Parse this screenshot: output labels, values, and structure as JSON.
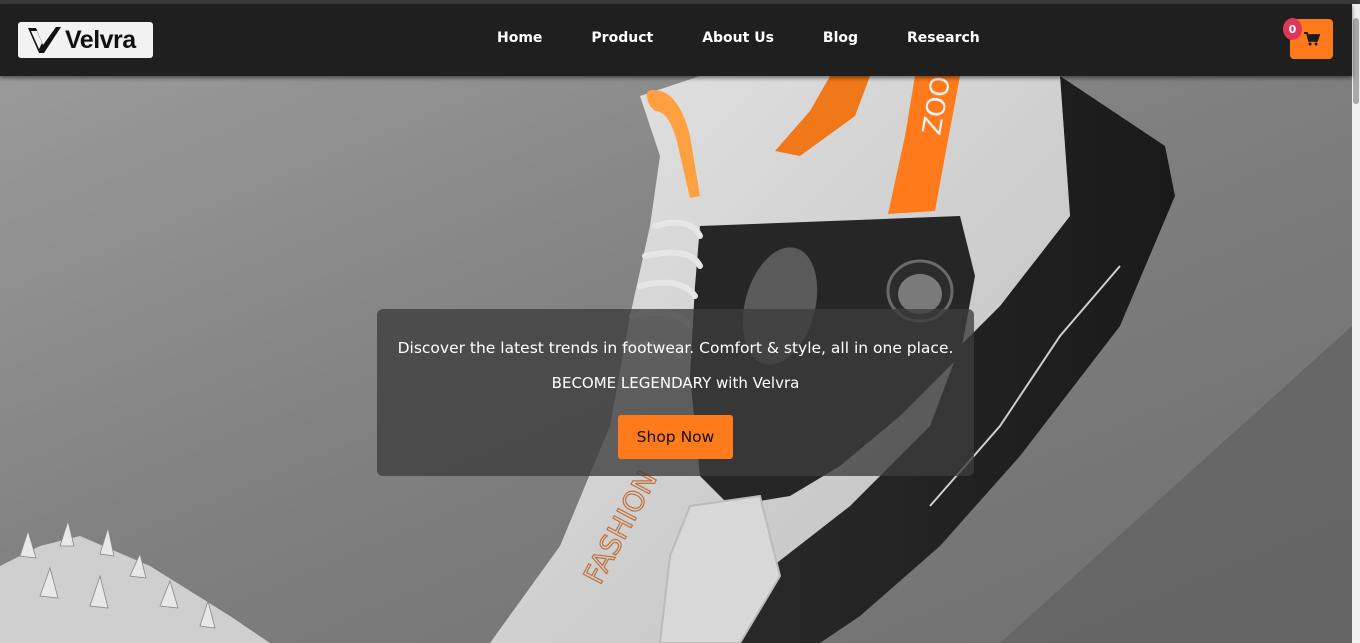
{
  "brand": {
    "name": "Velvra"
  },
  "nav": {
    "items": [
      {
        "label": "Home"
      },
      {
        "label": "Product"
      },
      {
        "label": "About Us"
      },
      {
        "label": "Blog"
      },
      {
        "label": "Research"
      }
    ]
  },
  "cart": {
    "count": "0",
    "icon": "cart-icon"
  },
  "hero": {
    "tagline": "Discover the latest trends in footwear. Comfort & style, all in one place.",
    "slogan": "BECOME LEGENDARY with Velvra",
    "cta_label": "Shop Now",
    "shoe_text_side": "FASHION",
    "shoe_text_strap": "ZOO"
  },
  "colors": {
    "accent": "#ff7a1a",
    "navbar": "#1f1f1f",
    "badge": "#e0355a"
  }
}
